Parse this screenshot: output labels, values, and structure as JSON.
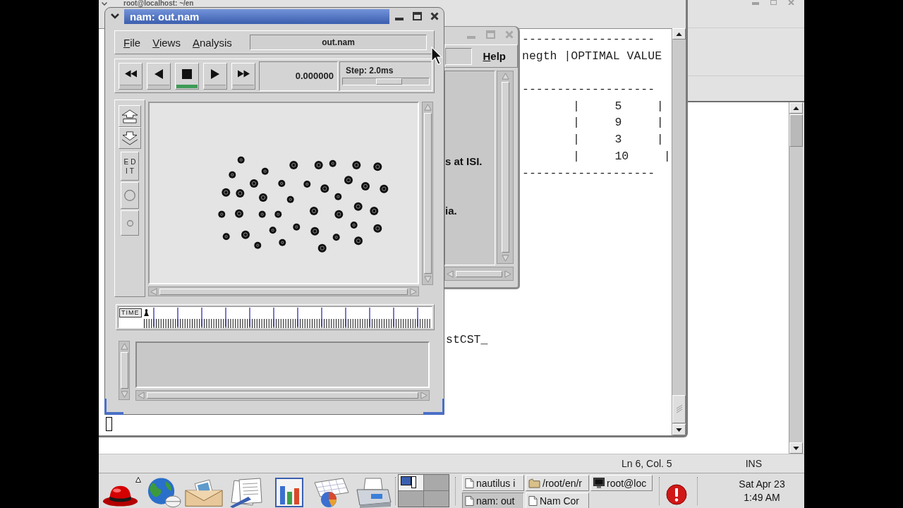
{
  "terminal_window": {
    "title": "root@localhost: ~/en",
    "lines": [
      {
        "kind": "rule",
        "text": "-------------------"
      },
      {
        "kind": "header",
        "text": "negth |OPTIMAL VALUE"
      },
      {
        "kind": "blank"
      },
      {
        "kind": "rule",
        "text": "-------------------"
      },
      {
        "kind": "row",
        "text": "|     5     |"
      },
      {
        "kind": "row",
        "text": "|     9     |"
      },
      {
        "kind": "row",
        "text": "|     3     |"
      },
      {
        "kind": "row",
        "text": "|     10     |"
      },
      {
        "kind": "rule",
        "text": "-------------------"
      },
      {
        "kind": "blank"
      },
      {
        "kind": "blank"
      },
      {
        "kind": "blank"
      },
      {
        "kind": "blank"
      },
      {
        "kind": "blank"
      },
      {
        "kind": "blank"
      },
      {
        "kind": "blank"
      },
      {
        "kind": "blank"
      },
      {
        "kind": "blank"
      },
      {
        "kind": "prompt",
        "text": "stCST_"
      },
      {
        "kind": "blank"
      },
      {
        "kind": "blank"
      },
      {
        "kind": "blank"
      },
      {
        "kind": "blank"
      },
      {
        "kind": "cursor"
      }
    ]
  },
  "console_window": {
    "menu": "Help",
    "lines": [
      "s at ISI.",
      "ia."
    ]
  },
  "nam_window": {
    "title": "nam: out.nam",
    "menus": [
      "File",
      "Views",
      "Analysis"
    ],
    "file_label": "out.nam",
    "playback_buttons": [
      {
        "kind": "rewind",
        "selected": false
      },
      {
        "kind": "back",
        "selected": false
      },
      {
        "kind": "stop",
        "selected": true
      },
      {
        "kind": "play",
        "selected": false
      },
      {
        "kind": "fast_forward",
        "selected": false
      }
    ],
    "time": "0.000000",
    "step": {
      "label": "Step: 2.0ms",
      "level": 0.55
    },
    "tools": [
      {
        "kind": "zoom_in"
      },
      {
        "kind": "zoom_out"
      },
      {
        "kind": "edit",
        "label": "EDIT"
      },
      {
        "kind": "circle"
      },
      {
        "kind": "small_circle"
      }
    ],
    "timeline": {
      "label": "TIME",
      "level": 0
    }
  },
  "editor_window": {
    "status_bar": {
      "position": "Ln 6, Col. 5",
      "mode": "INS"
    }
  },
  "taskbar": {
    "workspaces": [
      {
        "selected": true
      },
      {
        "selected": false
      },
      {
        "selected": false
      },
      {
        "selected": false
      }
    ],
    "tasks": [
      {
        "label": "nautilus i",
        "kind": "document",
        "selected": false
      },
      {
        "label": "/root/en/r",
        "kind": "folder",
        "selected": false
      },
      {
        "label": "root@loc",
        "kind": "terminal",
        "selected": false
      },
      {
        "label": "nam: out",
        "kind": "document",
        "selected": true
      },
      {
        "label": "Nam Cor",
        "kind": "document",
        "selected": false
      }
    ],
    "clock": {
      "date": "Sat Apr 23",
      "time": "1:49 AM"
    }
  }
}
